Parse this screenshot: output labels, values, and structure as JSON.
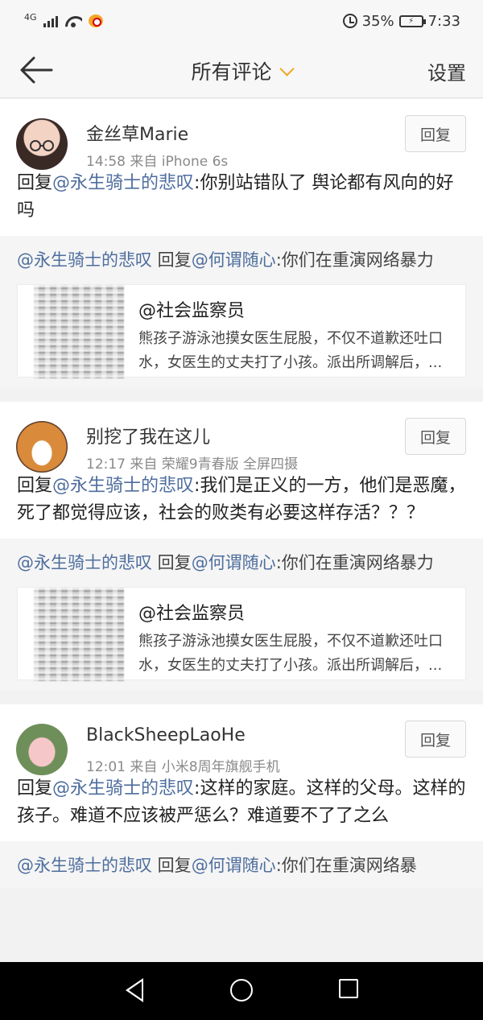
{
  "status_bar": {
    "network": "4G",
    "battery": "35%",
    "time": "7:33"
  },
  "header": {
    "title": "所有评论",
    "settings_label": "设置"
  },
  "reply_label": "回复",
  "comments": [
    {
      "username": "金丝草Marie",
      "meta": "14:58  来自 iPhone 6s",
      "reply_prefix": "回复",
      "mention": "@永生骑士的悲叹",
      "text": ":你别站错队了   舆论都有风向的好吗",
      "quote": {
        "mention1": "@永生骑士的悲叹",
        "reply_word": " 回复",
        "mention2": "@何谓随心",
        "text": ":你们在重演网络暴力",
        "orig_user": "@社会监察员",
        "orig_text": "熊孩子游泳池摸女医生屁股，不仅不道歉还吐口水，女医生的丈夫打了小孩。派出所调解后，..."
      }
    },
    {
      "username": "别挖了我在这儿",
      "meta": "12:17  来自 荣耀9青春版 全屏四摄",
      "reply_prefix": "回复",
      "mention": "@永生骑士的悲叹",
      "text": ":我们是正义的一方，他们是恶魔，死了都觉得应该，社会的败类有必要这样存活？？？",
      "quote": {
        "mention1": "@永生骑士的悲叹",
        "reply_word": " 回复",
        "mention2": "@何谓随心",
        "text": ":你们在重演网络暴力",
        "orig_user": "@社会监察员",
        "orig_text": "熊孩子游泳池摸女医生屁股，不仅不道歉还吐口水，女医生的丈夫打了小孩。派出所调解后，..."
      }
    },
    {
      "username": "BlackSheepLaoHe",
      "meta": "12:01  来自 小米8周年旗舰手机",
      "reply_prefix": "回复",
      "mention": "@永生骑士的悲叹",
      "text": ":这样的家庭。这样的父母。这样的孩子。难道不应该被严惩么？难道要不了了之么",
      "quote": {
        "mention1": "@永生骑士的悲叹",
        "reply_word": " 回复",
        "mention2": "@何谓随心",
        "text": ":你们在重演网络暴"
      }
    }
  ]
}
